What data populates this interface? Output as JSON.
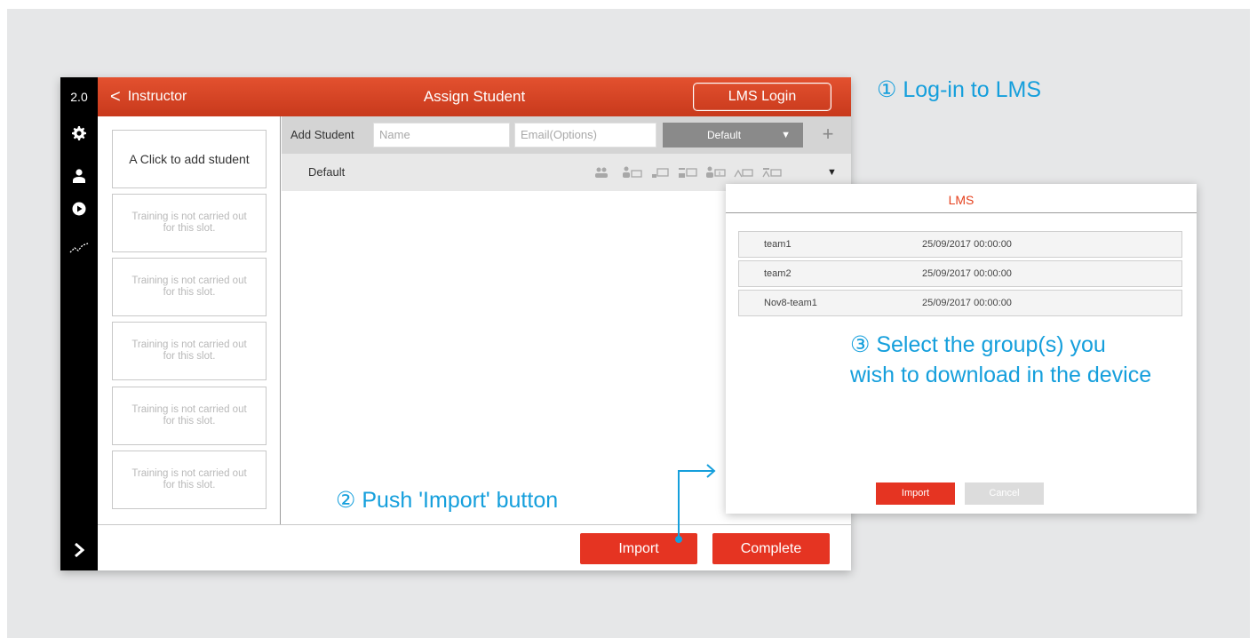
{
  "app": {
    "version": "2.0",
    "back_label": "Instructor",
    "title": "Assign Student",
    "lms_login_label": "LMS Login",
    "sidebar_icons": [
      "gear-icon",
      "person-icon",
      "play-icon",
      "chart-icon"
    ],
    "expand_icon": "chevron-right-icon"
  },
  "slots": {
    "first": "A   Click to add student",
    "empty_text": "Training is not carried out for this slot.",
    "empty_count": 5
  },
  "add_student": {
    "label": "Add Student",
    "name_placeholder": "Name",
    "email_placeholder": "Email(Options)",
    "group_value": "Default",
    "plus_label": "+"
  },
  "group_row": {
    "name": "Default",
    "icons": [
      "students-icon",
      "student-monitor-icon",
      "monitor-icon",
      "monitor-alt-icon",
      "student-mixed-icon",
      "mixed-icon",
      "mixed-alt-icon"
    ]
  },
  "bottom": {
    "import_label": "Import",
    "complete_label": "Complete"
  },
  "lms_dialog": {
    "title": "LMS",
    "rows": [
      {
        "name": "team1",
        "date": "25/09/2017 00:00:00"
      },
      {
        "name": "team2",
        "date": "25/09/2017 00:00:00"
      },
      {
        "name": "Nov8-team1",
        "date": "25/09/2017 00:00:00"
      }
    ],
    "import_label": "Import",
    "cancel_label": "Cancel"
  },
  "annotations": {
    "step1": "① Log-in to LMS",
    "step2": "② Push 'Import' button",
    "step3_line1": "③ Select the group(s) you",
    "step3_line2": "wish to download in the device"
  },
  "colors": {
    "accent_red": "#e53422",
    "header_red": "#d84527",
    "annotation_blue": "#159fdc",
    "background": "#e6e7e8"
  }
}
